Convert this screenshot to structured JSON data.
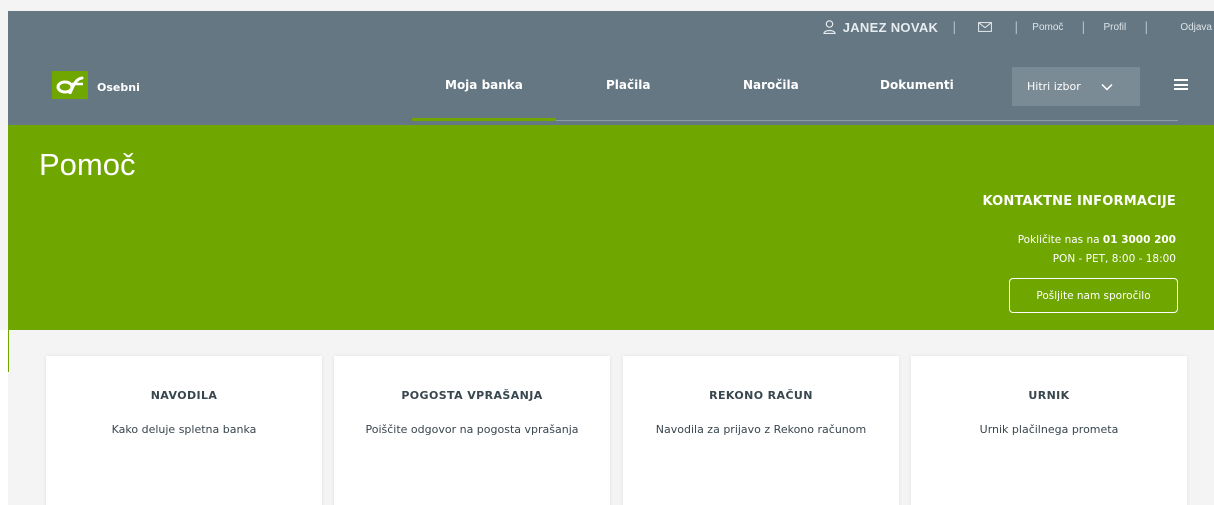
{
  "colors": {
    "header_bg": "#657782",
    "accent_green": "#6fa600",
    "quick_bg": "#7a8b96",
    "page_bg": "#f4f4f4",
    "card_text": "#38464e"
  },
  "utility": {
    "user_name": "JANEZ NOVAK",
    "user_icon": "user-icon",
    "mail_icon": "envelope-icon",
    "help": "Pomoč",
    "profile": "Profil",
    "logout": "Odjava",
    "sep": "|"
  },
  "brand": {
    "label": "Osebni",
    "logo_icon": "bank-logo-icon"
  },
  "nav": {
    "tabs": [
      {
        "label": "Moja banka",
        "active": true
      },
      {
        "label": "Plačila"
      },
      {
        "label": "Naročila"
      },
      {
        "label": "Dokumenti"
      }
    ],
    "quick_select": "Hitri izbor",
    "quick_icon": "chevron-down-icon",
    "menu_icon": "hamburger-menu-icon"
  },
  "hero": {
    "title": "Pomoč",
    "contact_heading": "KONTAKTNE INFORMACIJE",
    "call_prefix": "Pokličite nas na ",
    "phone": "01 3000 200",
    "hours": "PON - PET, 8:00 - 18:00",
    "message_button": "Pošljite nam sporočilo"
  },
  "cards": [
    {
      "title": "NAVODILA",
      "desc": "Kako deluje spletna banka"
    },
    {
      "title": "POGOSTA VPRAŠANJA",
      "desc": "Poiščite odgovor na pogosta vprašanja"
    },
    {
      "title": "REKONO RAČUN",
      "desc": "Navodila za prijavo z Rekono računom"
    },
    {
      "title": "URNIK",
      "desc": "Urnik plačilnega prometa"
    }
  ]
}
